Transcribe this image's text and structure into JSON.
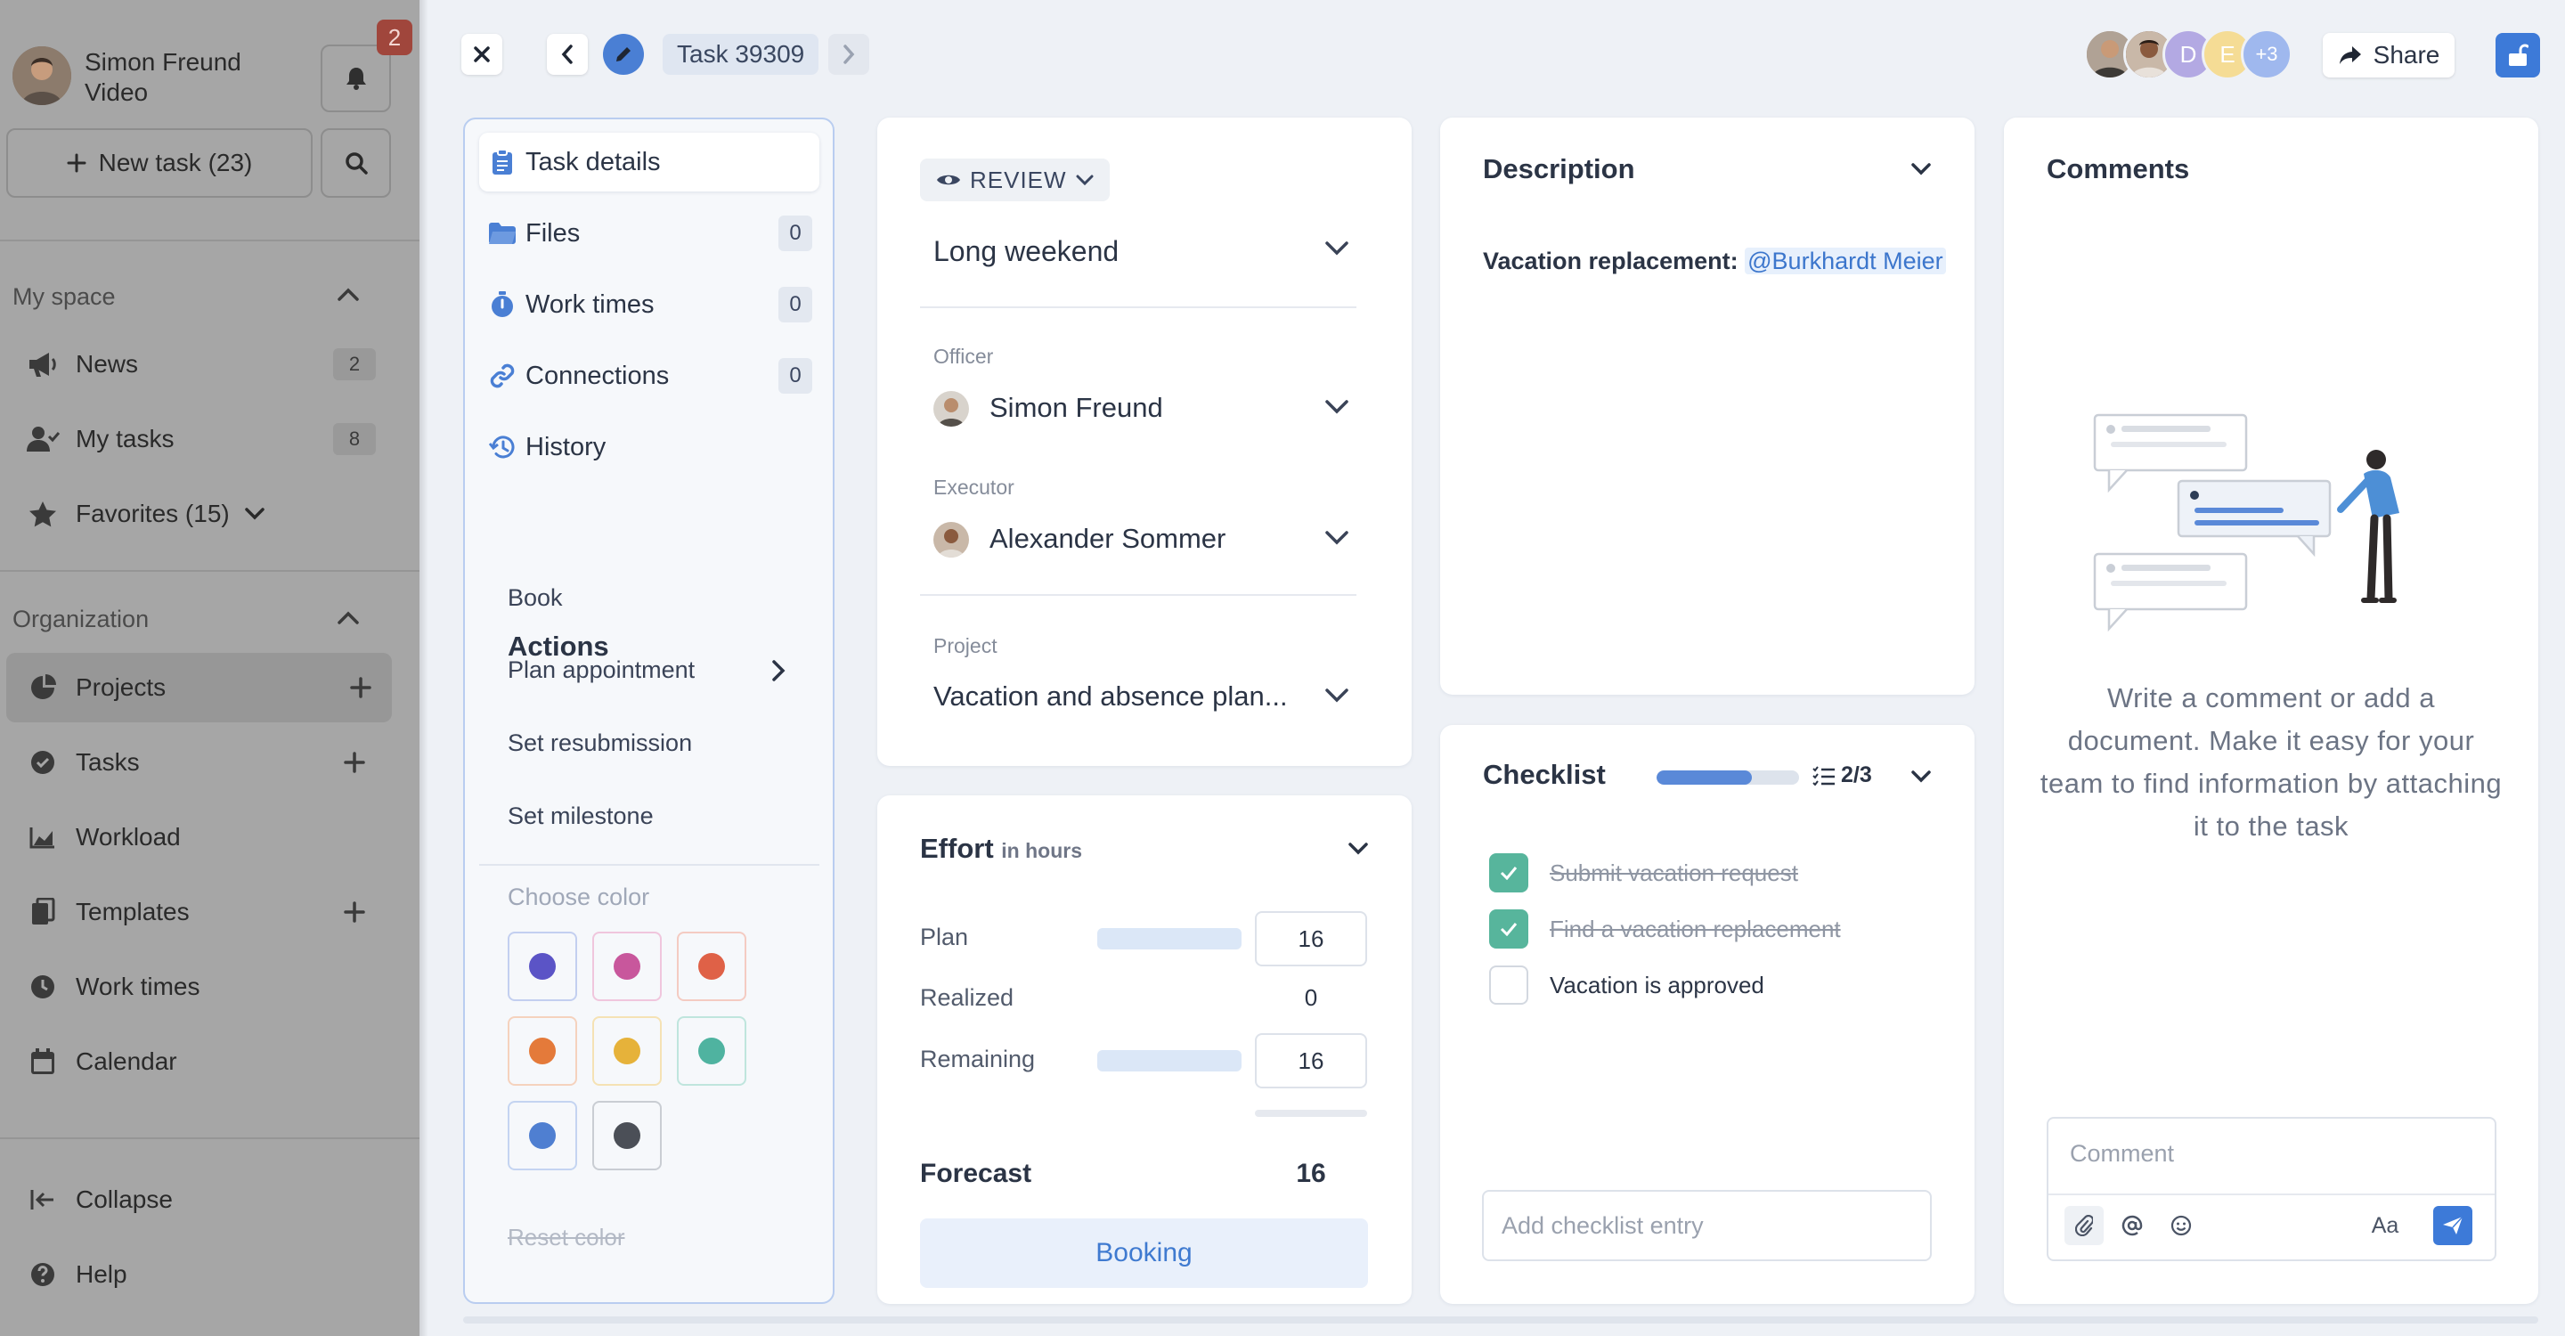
{
  "sidebar": {
    "user_name": "Simon Freund",
    "user_role": "Video",
    "notification_count": "2",
    "new_task_label": "New task (23)",
    "my_space_label": "My space",
    "my_space_items": [
      {
        "label": "News",
        "count": "2",
        "icon": "megaphone-icon"
      },
      {
        "label": "My tasks",
        "count": "8",
        "icon": "user-check-icon"
      },
      {
        "label": "Favorites (15)",
        "icon": "star-icon"
      }
    ],
    "organization_label": "Organization",
    "org_items": [
      {
        "label": "Projects",
        "icon": "pie-chart-icon",
        "active": true
      },
      {
        "label": "Tasks",
        "icon": "check-circle-icon"
      },
      {
        "label": "Workload",
        "icon": "area-chart-icon"
      },
      {
        "label": "Templates",
        "icon": "copy-icon"
      },
      {
        "label": "Work times",
        "icon": "clock-icon"
      },
      {
        "label": "Calendar",
        "icon": "calendar-icon"
      }
    ],
    "collapse_label": "Collapse",
    "help_label": "Help"
  },
  "topbar": {
    "task_label": "Task 39309",
    "avatar_letters": [
      "D",
      "E"
    ],
    "avatar_more": "+3",
    "share_label": "Share"
  },
  "task_nav": {
    "items": [
      {
        "label": "Task details",
        "icon": "clipboard-icon"
      },
      {
        "label": "Files",
        "count": "0",
        "icon": "folder-icon"
      },
      {
        "label": "Work times",
        "count": "0",
        "icon": "stopwatch-icon"
      },
      {
        "label": "Connections",
        "count": "0",
        "icon": "link-icon"
      },
      {
        "label": "History",
        "icon": "history-icon"
      }
    ],
    "actions_title": "Actions",
    "actions": [
      "Book",
      "Plan appointment",
      "Set resubmission",
      "Set milestone"
    ],
    "choose_color_label": "Choose color",
    "colors": [
      "#5b54c6",
      "#c8579c",
      "#df6147",
      "#e47a3a",
      "#e6b23a",
      "#4fb3a0",
      "#4f7fd1",
      "#4b4f57"
    ],
    "reset_color_label": "Reset color"
  },
  "fields": {
    "status": "REVIEW",
    "title": "Long weekend",
    "officer_label": "Officer",
    "officer": "Simon Freund",
    "executor_label": "Executor",
    "executor": "Alexander Sommer",
    "project_label": "Project",
    "project": "Vacation and absence plan..."
  },
  "effort": {
    "title": "Effort",
    "unit": "in hours",
    "plan_label": "Plan",
    "plan_value": "16",
    "realized_label": "Realized",
    "realized_value": "0",
    "remaining_label": "Remaining",
    "remaining_value": "16",
    "forecast_label": "Forecast",
    "forecast_value": "16",
    "booking_label": "Booking"
  },
  "description": {
    "title": "Description",
    "label": "Vacation replacement:",
    "mention": "@Burkhardt Meier"
  },
  "checklist": {
    "title": "Checklist",
    "progress": 0.67,
    "count": "2/3",
    "items": [
      {
        "label": "Submit vacation request",
        "done": true
      },
      {
        "label": "Find a vacation replacement",
        "done": true
      },
      {
        "label": "Vacation is approved",
        "done": false
      }
    ],
    "add_placeholder": "Add checklist entry"
  },
  "comments": {
    "title": "Comments",
    "hint": "Write a comment or add a document. Make it easy for your team to find information by attaching it to the task",
    "placeholder": "Comment",
    "format_label": "Aa"
  }
}
